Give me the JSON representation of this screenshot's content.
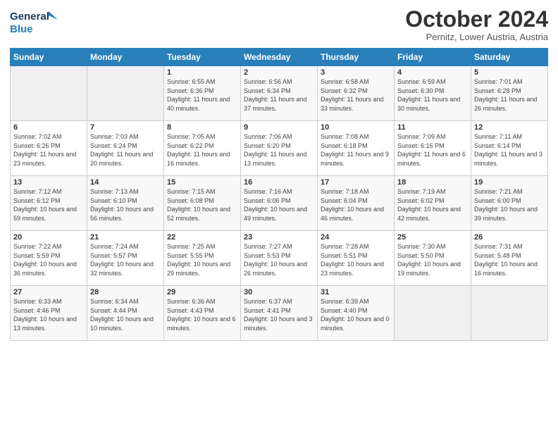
{
  "header": {
    "logo_general": "General",
    "logo_blue": "Blue",
    "month_title": "October 2024",
    "location": "Pernitz, Lower Austria, Austria"
  },
  "weekdays": [
    "Sunday",
    "Monday",
    "Tuesday",
    "Wednesday",
    "Thursday",
    "Friday",
    "Saturday"
  ],
  "weeks": [
    [
      {
        "day": "",
        "sunrise": "",
        "sunset": "",
        "daylight": "",
        "empty": true
      },
      {
        "day": "",
        "sunrise": "",
        "sunset": "",
        "daylight": "",
        "empty": true
      },
      {
        "day": "1",
        "sunrise": "Sunrise: 6:55 AM",
        "sunset": "Sunset: 6:36 PM",
        "daylight": "Daylight: 11 hours and 40 minutes.",
        "empty": false
      },
      {
        "day": "2",
        "sunrise": "Sunrise: 6:56 AM",
        "sunset": "Sunset: 6:34 PM",
        "daylight": "Daylight: 11 hours and 37 minutes.",
        "empty": false
      },
      {
        "day": "3",
        "sunrise": "Sunrise: 6:58 AM",
        "sunset": "Sunset: 6:32 PM",
        "daylight": "Daylight: 11 hours and 33 minutes.",
        "empty": false
      },
      {
        "day": "4",
        "sunrise": "Sunrise: 6:59 AM",
        "sunset": "Sunset: 6:30 PM",
        "daylight": "Daylight: 11 hours and 30 minutes.",
        "empty": false
      },
      {
        "day": "5",
        "sunrise": "Sunrise: 7:01 AM",
        "sunset": "Sunset: 6:28 PM",
        "daylight": "Daylight: 11 hours and 26 minutes.",
        "empty": false
      }
    ],
    [
      {
        "day": "6",
        "sunrise": "Sunrise: 7:02 AM",
        "sunset": "Sunset: 6:26 PM",
        "daylight": "Daylight: 11 hours and 23 minutes.",
        "empty": false
      },
      {
        "day": "7",
        "sunrise": "Sunrise: 7:03 AM",
        "sunset": "Sunset: 6:24 PM",
        "daylight": "Daylight: 11 hours and 20 minutes.",
        "empty": false
      },
      {
        "day": "8",
        "sunrise": "Sunrise: 7:05 AM",
        "sunset": "Sunset: 6:22 PM",
        "daylight": "Daylight: 11 hours and 16 minutes.",
        "empty": false
      },
      {
        "day": "9",
        "sunrise": "Sunrise: 7:06 AM",
        "sunset": "Sunset: 6:20 PM",
        "daylight": "Daylight: 11 hours and 13 minutes.",
        "empty": false
      },
      {
        "day": "10",
        "sunrise": "Sunrise: 7:08 AM",
        "sunset": "Sunset: 6:18 PM",
        "daylight": "Daylight: 11 hours and 9 minutes.",
        "empty": false
      },
      {
        "day": "11",
        "sunrise": "Sunrise: 7:09 AM",
        "sunset": "Sunset: 6:16 PM",
        "daylight": "Daylight: 11 hours and 6 minutes.",
        "empty": false
      },
      {
        "day": "12",
        "sunrise": "Sunrise: 7:11 AM",
        "sunset": "Sunset: 6:14 PM",
        "daylight": "Daylight: 11 hours and 3 minutes.",
        "empty": false
      }
    ],
    [
      {
        "day": "13",
        "sunrise": "Sunrise: 7:12 AM",
        "sunset": "Sunset: 6:12 PM",
        "daylight": "Daylight: 10 hours and 59 minutes.",
        "empty": false
      },
      {
        "day": "14",
        "sunrise": "Sunrise: 7:13 AM",
        "sunset": "Sunset: 6:10 PM",
        "daylight": "Daylight: 10 hours and 56 minutes.",
        "empty": false
      },
      {
        "day": "15",
        "sunrise": "Sunrise: 7:15 AM",
        "sunset": "Sunset: 6:08 PM",
        "daylight": "Daylight: 10 hours and 52 minutes.",
        "empty": false
      },
      {
        "day": "16",
        "sunrise": "Sunrise: 7:16 AM",
        "sunset": "Sunset: 6:06 PM",
        "daylight": "Daylight: 10 hours and 49 minutes.",
        "empty": false
      },
      {
        "day": "17",
        "sunrise": "Sunrise: 7:18 AM",
        "sunset": "Sunset: 6:04 PM",
        "daylight": "Daylight: 10 hours and 46 minutes.",
        "empty": false
      },
      {
        "day": "18",
        "sunrise": "Sunrise: 7:19 AM",
        "sunset": "Sunset: 6:02 PM",
        "daylight": "Daylight: 10 hours and 42 minutes.",
        "empty": false
      },
      {
        "day": "19",
        "sunrise": "Sunrise: 7:21 AM",
        "sunset": "Sunset: 6:00 PM",
        "daylight": "Daylight: 10 hours and 39 minutes.",
        "empty": false
      }
    ],
    [
      {
        "day": "20",
        "sunrise": "Sunrise: 7:22 AM",
        "sunset": "Sunset: 5:59 PM",
        "daylight": "Daylight: 10 hours and 36 minutes.",
        "empty": false
      },
      {
        "day": "21",
        "sunrise": "Sunrise: 7:24 AM",
        "sunset": "Sunset: 5:57 PM",
        "daylight": "Daylight: 10 hours and 32 minutes.",
        "empty": false
      },
      {
        "day": "22",
        "sunrise": "Sunrise: 7:25 AM",
        "sunset": "Sunset: 5:55 PM",
        "daylight": "Daylight: 10 hours and 29 minutes.",
        "empty": false
      },
      {
        "day": "23",
        "sunrise": "Sunrise: 7:27 AM",
        "sunset": "Sunset: 5:53 PM",
        "daylight": "Daylight: 10 hours and 26 minutes.",
        "empty": false
      },
      {
        "day": "24",
        "sunrise": "Sunrise: 7:28 AM",
        "sunset": "Sunset: 5:51 PM",
        "daylight": "Daylight: 10 hours and 23 minutes.",
        "empty": false
      },
      {
        "day": "25",
        "sunrise": "Sunrise: 7:30 AM",
        "sunset": "Sunset: 5:50 PM",
        "daylight": "Daylight: 10 hours and 19 minutes.",
        "empty": false
      },
      {
        "day": "26",
        "sunrise": "Sunrise: 7:31 AM",
        "sunset": "Sunset: 5:48 PM",
        "daylight": "Daylight: 10 hours and 16 minutes.",
        "empty": false
      }
    ],
    [
      {
        "day": "27",
        "sunrise": "Sunrise: 6:33 AM",
        "sunset": "Sunset: 4:46 PM",
        "daylight": "Daylight: 10 hours and 13 minutes.",
        "empty": false
      },
      {
        "day": "28",
        "sunrise": "Sunrise: 6:34 AM",
        "sunset": "Sunset: 4:44 PM",
        "daylight": "Daylight: 10 hours and 10 minutes.",
        "empty": false
      },
      {
        "day": "29",
        "sunrise": "Sunrise: 6:36 AM",
        "sunset": "Sunset: 4:43 PM",
        "daylight": "Daylight: 10 hours and 6 minutes.",
        "empty": false
      },
      {
        "day": "30",
        "sunrise": "Sunrise: 6:37 AM",
        "sunset": "Sunset: 4:41 PM",
        "daylight": "Daylight: 10 hours and 3 minutes.",
        "empty": false
      },
      {
        "day": "31",
        "sunrise": "Sunrise: 6:39 AM",
        "sunset": "Sunset: 4:40 PM",
        "daylight": "Daylight: 10 hours and 0 minutes.",
        "empty": false
      },
      {
        "day": "",
        "sunrise": "",
        "sunset": "",
        "daylight": "",
        "empty": true
      },
      {
        "day": "",
        "sunrise": "",
        "sunset": "",
        "daylight": "",
        "empty": true
      }
    ]
  ]
}
